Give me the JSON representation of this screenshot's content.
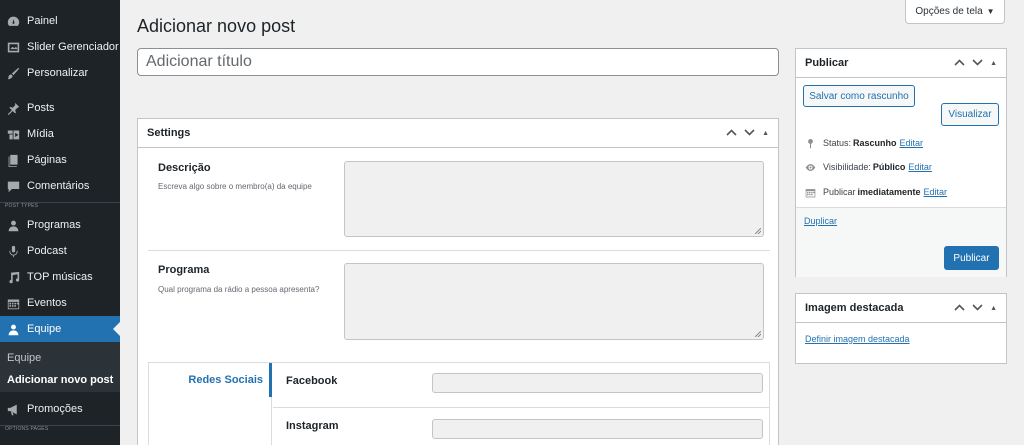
{
  "sidebar": {
    "items": [
      {
        "label": "Painel",
        "icon": "dashboard-icon"
      },
      {
        "label": "Slider Gerenciador",
        "icon": "slider-icon"
      },
      {
        "label": "Personalizar",
        "icon": "customize-icon"
      },
      {
        "label": "Posts",
        "icon": "pin-icon"
      },
      {
        "label": "Mídia",
        "icon": "media-icon"
      },
      {
        "label": "Páginas",
        "icon": "pages-icon"
      },
      {
        "label": "Comentários",
        "icon": "comments-icon"
      },
      {
        "label": "Programas",
        "icon": "users-icon"
      },
      {
        "label": "Podcast",
        "icon": "microphone-icon"
      },
      {
        "label": "TOP músicas",
        "icon": "music-icon"
      },
      {
        "label": "Eventos",
        "icon": "calendar-icon"
      },
      {
        "label": "Equipe",
        "icon": "user-icon"
      },
      {
        "label": "Promoções",
        "icon": "megaphone-icon"
      }
    ],
    "separator_post_types": "POST TYPES",
    "separator_options_pages": "OPTIONS PAGES",
    "submenu": {
      "items": [
        "Equipe",
        "Adicionar novo post"
      ],
      "current": "Adicionar novo post"
    }
  },
  "header": {
    "title": "Adicionar novo post",
    "screen_options": "Opções de tela"
  },
  "editor": {
    "title_placeholder": "Adicionar título"
  },
  "settings_box": {
    "title": "Settings",
    "fields": [
      {
        "label": "Descrição",
        "description": "Escreva algo sobre o membro(a) da equipe"
      },
      {
        "label": "Programa",
        "description": "Qual programa da rádio a pessoa apresenta?"
      }
    ],
    "tab_label": "Redes Sociais",
    "social_fields": [
      "Facebook",
      "Instagram"
    ]
  },
  "publish_box": {
    "title": "Publicar",
    "save_draft": "Salvar como rascunho",
    "preview": "Visualizar",
    "status_label": "Status:",
    "status_value": "Rascunho",
    "visibility_label": "Visibilidade:",
    "visibility_value": "Público",
    "schedule_label": "Publicar",
    "schedule_value": "imediatamente",
    "edit_link": "Editar",
    "duplicate_link": "Duplicar",
    "publish_button": "Publicar"
  },
  "featured_box": {
    "title": "Imagem destacada",
    "set_link": "Definir imagem destacada"
  },
  "colors": {
    "sidebar_bg": "#1d2327",
    "accent": "#2271b1",
    "background": "#f0f0f1"
  }
}
